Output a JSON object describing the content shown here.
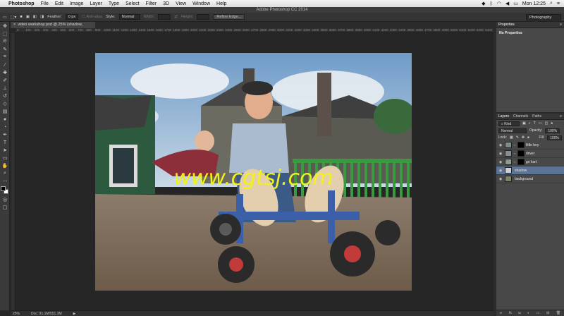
{
  "menubar": {
    "app": "Photoshop",
    "items": [
      "File",
      "Edit",
      "Image",
      "Layer",
      "Type",
      "Select",
      "Filter",
      "3D",
      "View",
      "Window",
      "Help"
    ],
    "clock": "Mon 12:25"
  },
  "title": "Adobe Photoshop CC 2014",
  "options": {
    "feather_label": "Feather:",
    "feather_value": "0 px",
    "antialias": "Anti-alias",
    "style_label": "Style:",
    "style_value": "Normal",
    "width_label": "Width:",
    "height_label": "Height:",
    "refine_edge": "Refine Edge...",
    "workspace": "Photography"
  },
  "document": {
    "tab": "video workshop.psd @ 25% (shadow, RGB/16)"
  },
  "ruler": [
    "0",
    "100",
    "200",
    "300",
    "400",
    "500",
    "600",
    "700",
    "800",
    "900",
    "1000",
    "1100",
    "1200",
    "1300",
    "1400",
    "1500",
    "1600",
    "1700",
    "1800",
    "1900",
    "2000",
    "2100",
    "2200",
    "2300",
    "2400",
    "2500",
    "2600",
    "2700",
    "2800",
    "2900",
    "3000",
    "3100",
    "3200",
    "3300",
    "3400",
    "3500",
    "3600",
    "3700",
    "3800",
    "3900",
    "4000",
    "4100",
    "4200",
    "4300",
    "4400",
    "4500",
    "4600",
    "4700",
    "4800",
    "4900",
    "5000",
    "5100",
    "5200",
    "5300",
    "5400",
    "5500"
  ],
  "watermark": "www.cgtsj.com",
  "status": {
    "zoom": "25%",
    "doc": "Doc: 91.1M/551.3M"
  },
  "properties": {
    "tab": "Properties",
    "body": "No Properties"
  },
  "layers_panel": {
    "tabs": [
      "Layers",
      "Channels",
      "Paths"
    ],
    "kind": "Kind",
    "blend_mode": "Normal",
    "opacity_label": "Opacity:",
    "opacity_value": "100%",
    "lock_label": "Lock:",
    "fill_label": "Fill:",
    "fill_value": "100%",
    "layers": [
      {
        "name": "little boy",
        "selected": false,
        "has_mask": true
      },
      {
        "name": "driver",
        "selected": false,
        "has_mask": true
      },
      {
        "name": "go kart",
        "selected": false,
        "has_mask": true
      },
      {
        "name": "shadow",
        "selected": true,
        "has_mask": false
      },
      {
        "name": "background",
        "selected": false,
        "has_mask": false
      }
    ]
  },
  "colors": {
    "selection": "#5c7394",
    "watermark": "#f2f21a"
  }
}
